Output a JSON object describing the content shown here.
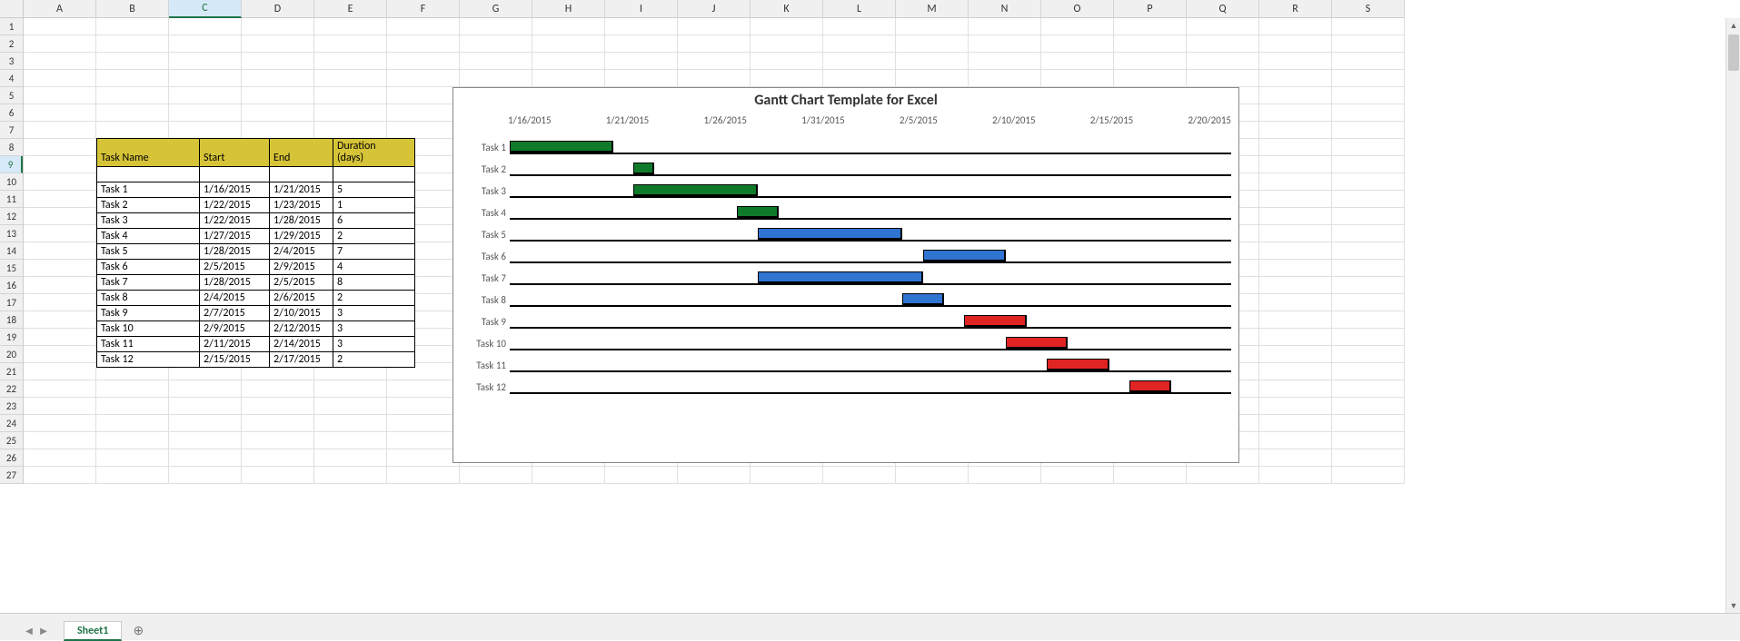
{
  "columns": [
    "A",
    "B",
    "C",
    "D",
    "E",
    "F",
    "G",
    "H",
    "I",
    "J",
    "K",
    "L",
    "M",
    "N",
    "O",
    "P",
    "Q",
    "R",
    "S"
  ],
  "rows_visible": 27,
  "active_cell": {
    "col": 2,
    "row": 8
  },
  "table": {
    "headers": {
      "task": "Task Name",
      "start": "Start",
      "end": "End",
      "dur_line1": "Duration",
      "dur_line2": "(days)"
    },
    "rows": [
      {
        "task": "Task 1",
        "start": "1/16/2015",
        "end": "1/21/2015",
        "dur": "5"
      },
      {
        "task": "Task 2",
        "start": "1/22/2015",
        "end": "1/23/2015",
        "dur": "1"
      },
      {
        "task": "Task 3",
        "start": "1/22/2015",
        "end": "1/28/2015",
        "dur": "6"
      },
      {
        "task": "Task 4",
        "start": "1/27/2015",
        "end": "1/29/2015",
        "dur": "2"
      },
      {
        "task": "Task 5",
        "start": "1/28/2015",
        "end": "2/4/2015",
        "dur": "7"
      },
      {
        "task": "Task 6",
        "start": "2/5/2015",
        "end": "2/9/2015",
        "dur": "4"
      },
      {
        "task": "Task 7",
        "start": "1/28/2015",
        "end": "2/5/2015",
        "dur": "8"
      },
      {
        "task": "Task 8",
        "start": "2/4/2015",
        "end": "2/6/2015",
        "dur": "2"
      },
      {
        "task": "Task 9",
        "start": "2/7/2015",
        "end": "2/10/2015",
        "dur": "3"
      },
      {
        "task": "Task 10",
        "start": "2/9/2015",
        "end": "2/12/2015",
        "dur": "3"
      },
      {
        "task": "Task 11",
        "start": "2/11/2015",
        "end": "2/14/2015",
        "dur": "3"
      },
      {
        "task": "Task 12",
        "start": "2/15/2015",
        "end": "2/17/2015",
        "dur": "2"
      }
    ]
  },
  "chart_data": {
    "type": "bar",
    "title": "Gantt Chart Template for Excel",
    "x_axis_labels": [
      "1/16/2015",
      "1/21/2015",
      "1/26/2015",
      "1/31/2015",
      "2/5/2015",
      "2/10/2015",
      "2/15/2015",
      "2/20/2015"
    ],
    "x_min_serial": 42020,
    "x_max_serial": 42055,
    "categories": [
      "Task 1",
      "Task 2",
      "Task 3",
      "Task 4",
      "Task 5",
      "Task 6",
      "Task 7",
      "Task 8",
      "Task 9",
      "Task 10",
      "Task 11",
      "Task 12"
    ],
    "bars": [
      {
        "label": "Task 1",
        "start": 42020,
        "dur": 5,
        "color": "green"
      },
      {
        "label": "Task 2",
        "start": 42026,
        "dur": 1,
        "color": "green"
      },
      {
        "label": "Task 3",
        "start": 42026,
        "dur": 6,
        "color": "green"
      },
      {
        "label": "Task 4",
        "start": 42031,
        "dur": 2,
        "color": "green"
      },
      {
        "label": "Task 5",
        "start": 42032,
        "dur": 7,
        "color": "blue"
      },
      {
        "label": "Task 6",
        "start": 42040,
        "dur": 4,
        "color": "blue"
      },
      {
        "label": "Task 7",
        "start": 42032,
        "dur": 8,
        "color": "blue"
      },
      {
        "label": "Task 8",
        "start": 42039,
        "dur": 2,
        "color": "blue"
      },
      {
        "label": "Task 9",
        "start": 42042,
        "dur": 3,
        "color": "red"
      },
      {
        "label": "Task 10",
        "start": 42044,
        "dur": 3,
        "color": "red"
      },
      {
        "label": "Task 11",
        "start": 42046,
        "dur": 3,
        "color": "red"
      },
      {
        "label": "Task 12",
        "start": 42050,
        "dur": 2,
        "color": "red"
      }
    ]
  },
  "sheet_tab": "Sheet1",
  "newtab_glyph": "⊕"
}
